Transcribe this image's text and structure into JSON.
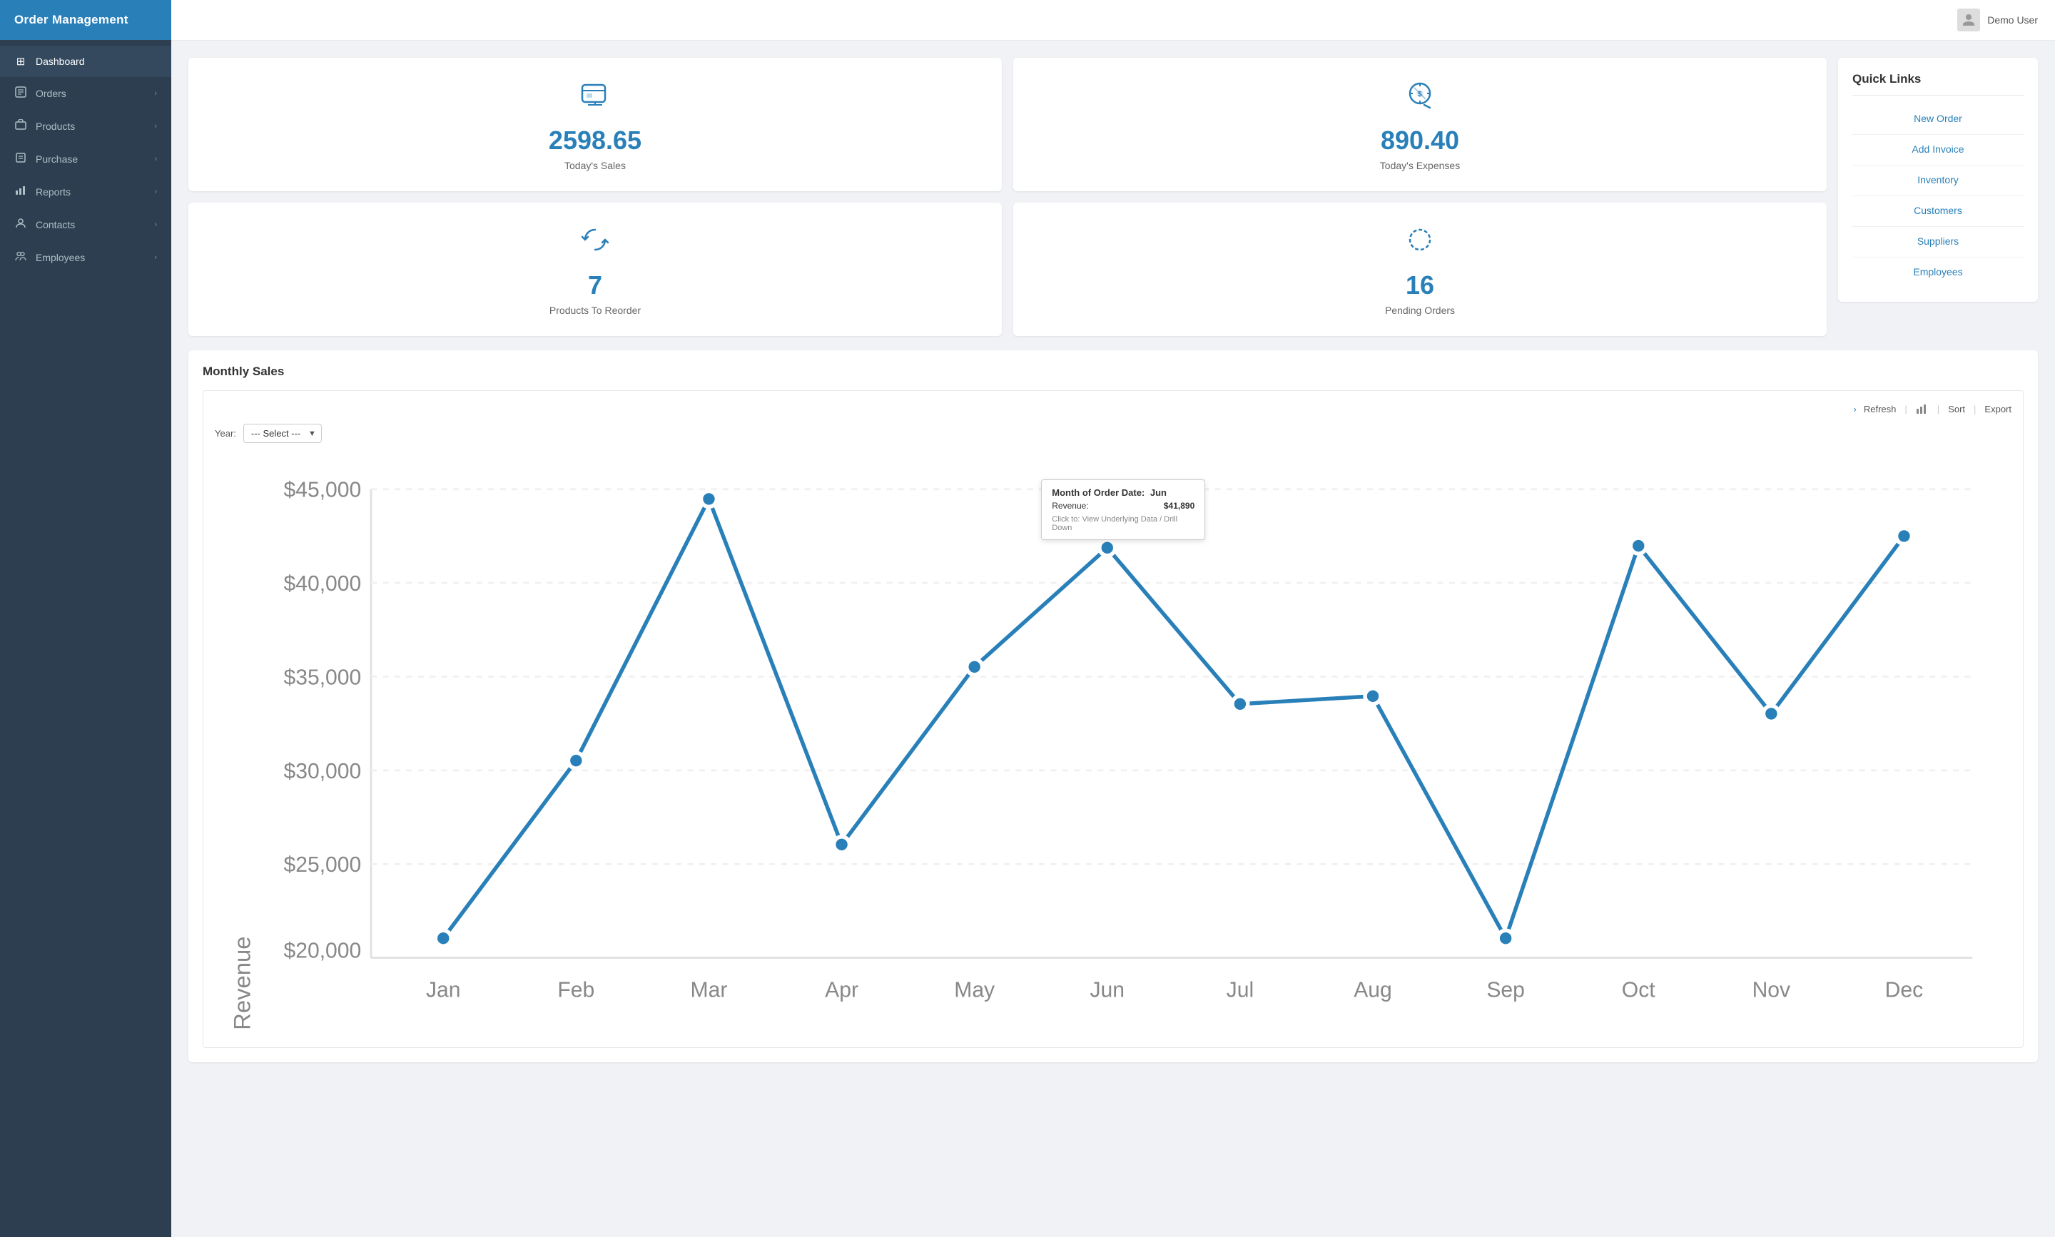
{
  "app": {
    "title": "Order Management"
  },
  "topbar": {
    "user": "Demo User"
  },
  "sidebar": {
    "items": [
      {
        "id": "dashboard",
        "label": "Dashboard",
        "icon": "⊞",
        "active": true,
        "arrow": false
      },
      {
        "id": "orders",
        "label": "Orders",
        "icon": "🛒",
        "active": false,
        "arrow": true
      },
      {
        "id": "products",
        "label": "Products",
        "icon": "🏷",
        "active": false,
        "arrow": true
      },
      {
        "id": "purchase",
        "label": "Purchase",
        "icon": "📋",
        "active": false,
        "arrow": true
      },
      {
        "id": "reports",
        "label": "Reports",
        "icon": "📊",
        "active": false,
        "arrow": true
      },
      {
        "id": "contacts",
        "label": "Contacts",
        "icon": "👤",
        "active": false,
        "arrow": true
      },
      {
        "id": "employees",
        "label": "Employees",
        "icon": "👥",
        "active": false,
        "arrow": true
      }
    ]
  },
  "stats": {
    "sales": {
      "value": "2598.65",
      "label": "Today's Sales"
    },
    "expenses": {
      "value": "890.40",
      "label": "Today's Expenses"
    },
    "reorder": {
      "value": "7",
      "label": "Products To Reorder"
    },
    "pending": {
      "value": "16",
      "label": "Pending Orders"
    }
  },
  "quick_links": {
    "title": "Quick Links",
    "items": [
      {
        "id": "new-order",
        "label": "New Order"
      },
      {
        "id": "add-invoice",
        "label": "Add Invoice"
      },
      {
        "id": "inventory",
        "label": "Inventory"
      },
      {
        "id": "customers",
        "label": "Customers"
      },
      {
        "id": "suppliers",
        "label": "Suppliers"
      },
      {
        "id": "employees",
        "label": "Employees"
      }
    ]
  },
  "monthly_sales": {
    "title": "Monthly Sales",
    "year_label": "Year:",
    "year_placeholder": "--- Select ---",
    "chart_toolbar": {
      "refresh": "Refresh",
      "sort": "Sort",
      "export": "Export"
    },
    "tooltip": {
      "title_label": "Month of Order Date:",
      "title_value": "Jun",
      "revenue_label": "Revenue:",
      "revenue_value": "$41,890",
      "hint": "Click to: View Underlying Data / Drill Down"
    },
    "months": [
      "Jan",
      "Feb",
      "Mar",
      "Apr",
      "May",
      "Jun",
      "Jul",
      "Aug",
      "Sep",
      "Oct",
      "Nov",
      "Dec"
    ],
    "y_labels": [
      "$45,000",
      "$40,000",
      "$35,000",
      "$30,000",
      "$25,000",
      "$20,000"
    ],
    "data_points": [
      21000,
      30500,
      44500,
      26000,
      35500,
      41890,
      33500,
      34000,
      21000,
      42000,
      33000,
      42500
    ],
    "y_axis_label": "Revenue"
  }
}
